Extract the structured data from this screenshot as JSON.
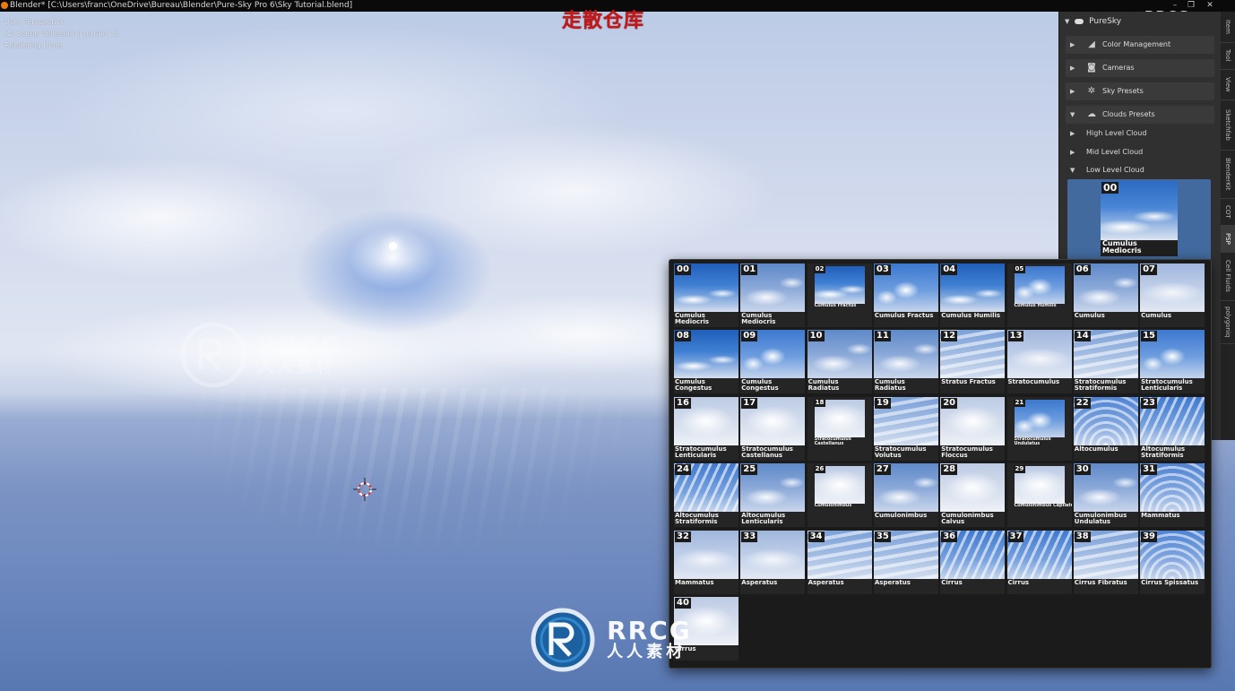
{
  "window": {
    "title": "Blender* [C:\\Users\\franc\\OneDrive\\Bureau\\Blender\\Pure-Sky Pro 6\\Sky Tutorial.blend]"
  },
  "viewport": {
    "line1": "User Perspective",
    "line2": "(1) Scene Collection | terrain 15",
    "line3": "Rendering Done"
  },
  "watermarks": {
    "top": "走散仓库",
    "corner": "RRCG.cn",
    "brand": "RRCG",
    "brand_sub": "人人素材"
  },
  "npanel": {
    "header": "PureSky",
    "sections": [
      {
        "label": "Color Management",
        "icon": "color-management-icon",
        "expanded": false
      },
      {
        "label": "Cameras",
        "icon": "camera-icon",
        "expanded": false
      },
      {
        "label": "Sky Presets",
        "icon": "sun-icon",
        "expanded": false
      },
      {
        "label": "Clouds Presets",
        "icon": "cloud-icon",
        "expanded": true
      }
    ],
    "sub_sections": [
      {
        "label": "High Level Cloud",
        "expanded": false
      },
      {
        "label": "Mid Level Cloud",
        "expanded": false
      },
      {
        "label": "Low Level Cloud",
        "expanded": true
      }
    ],
    "selected_preset": {
      "number": "00",
      "name": "Cumulus Mediocris"
    },
    "tabs": [
      "Item",
      "Tool",
      "View",
      "Sketchfab",
      "BlenderKit",
      "COT",
      "PSP",
      "Cell Fluids",
      "polygoniq"
    ],
    "active_tab": "PSP"
  },
  "presets": [
    {
      "n": "00",
      "name": "Cumulus Mediocris",
      "small": false
    },
    {
      "n": "01",
      "name": "Cumulus Mediocris",
      "small": false
    },
    {
      "n": "02",
      "name": "Cumulus Fractus",
      "small": true
    },
    {
      "n": "03",
      "name": "Cumulus Fractus",
      "small": false
    },
    {
      "n": "04",
      "name": "Cumulus Humilis",
      "small": false
    },
    {
      "n": "05",
      "name": "Cumulus Humilis",
      "small": true
    },
    {
      "n": "06",
      "name": "Cumulus",
      "small": false
    },
    {
      "n": "07",
      "name": "Cumulus",
      "small": false
    },
    {
      "n": "08",
      "name": "Cumulus Congestus",
      "small": false
    },
    {
      "n": "09",
      "name": "Cumulus Congestus",
      "small": false
    },
    {
      "n": "10",
      "name": "Cumulus Radiatus",
      "small": false
    },
    {
      "n": "11",
      "name": "Cumulus Radiatus",
      "small": false
    },
    {
      "n": "12",
      "name": "Stratus Fractus",
      "small": false
    },
    {
      "n": "13",
      "name": "Stratocumulus",
      "small": false
    },
    {
      "n": "14",
      "name": "Stratocumulus Stratiformis",
      "small": false
    },
    {
      "n": "15",
      "name": "Stratocumulus Lenticularis",
      "small": false
    },
    {
      "n": "16",
      "name": "Stratocumulus Lenticularis",
      "small": false
    },
    {
      "n": "17",
      "name": "Stratocumulus Castellanus",
      "small": false
    },
    {
      "n": "18",
      "name": "Stratocumulus Castellanus",
      "small": true
    },
    {
      "n": "19",
      "name": "Stratocumulus Volutus",
      "small": false
    },
    {
      "n": "20",
      "name": "Stratocumulus Floccus",
      "small": false
    },
    {
      "n": "21",
      "name": "Stratocumulus Undulatus",
      "small": true
    },
    {
      "n": "22",
      "name": "Altocumulus",
      "small": false
    },
    {
      "n": "23",
      "name": "Altocumulus Stratiformis",
      "small": false
    },
    {
      "n": "24",
      "name": "Altocumulus Stratiformis",
      "small": false
    },
    {
      "n": "25",
      "name": "Altocumulus Lenticularis",
      "small": false
    },
    {
      "n": "26",
      "name": "Cumulonimbus",
      "small": true
    },
    {
      "n": "27",
      "name": "Cumulonimbus",
      "small": false
    },
    {
      "n": "28",
      "name": "Cumulonimbus Calvus",
      "small": false
    },
    {
      "n": "29",
      "name": "Cumulonimbus Capilatus",
      "small": true
    },
    {
      "n": "30",
      "name": "Cumulonimbus Undulatus",
      "small": false
    },
    {
      "n": "31",
      "name": "Mammatus",
      "small": false
    },
    {
      "n": "32",
      "name": "Mammatus",
      "small": false
    },
    {
      "n": "33",
      "name": "Asperatus",
      "small": false
    },
    {
      "n": "34",
      "name": "Asperatus",
      "small": false
    },
    {
      "n": "35",
      "name": "Asperatus",
      "small": false
    },
    {
      "n": "36",
      "name": "Cirrus",
      "small": false
    },
    {
      "n": "37",
      "name": "Cirrus",
      "small": false
    },
    {
      "n": "38",
      "name": "Cirrus Fibratus",
      "small": false
    },
    {
      "n": "39",
      "name": "Cirrus Spissatus",
      "small": false
    },
    {
      "n": "40",
      "name": "Cirrus",
      "small": false
    }
  ]
}
